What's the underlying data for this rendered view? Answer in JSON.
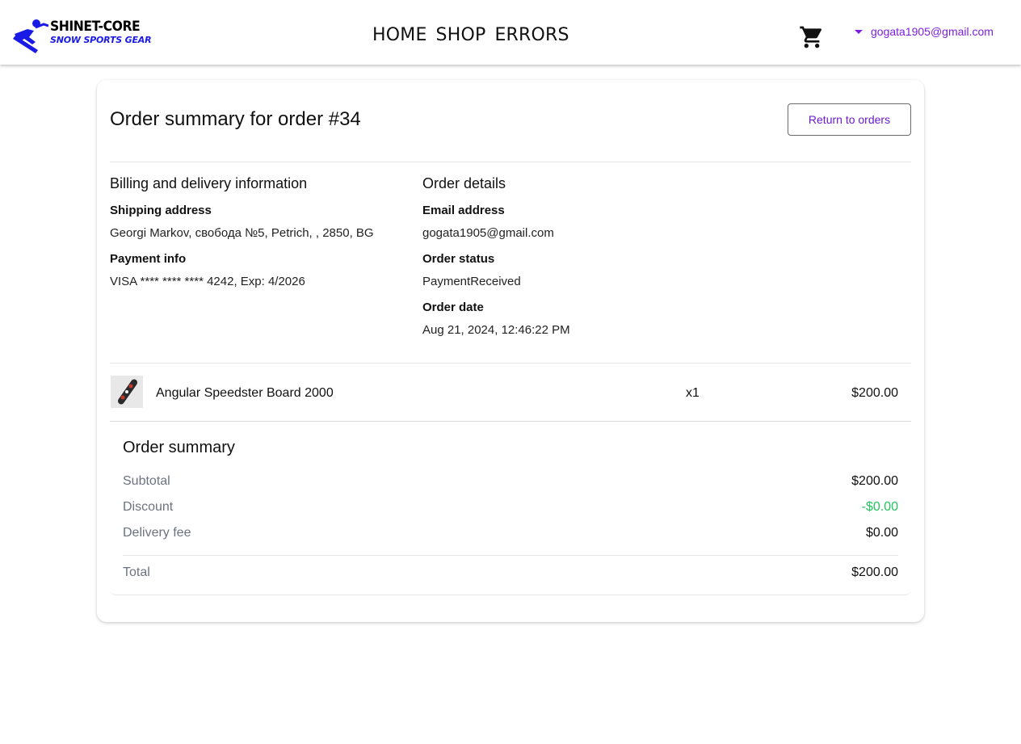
{
  "brand": {
    "line1": "SHINET-CORE",
    "line2": "SNOW SPORTS GEAR",
    "icon": "snowboarder-logo-icon",
    "color": "#1a1ae6"
  },
  "nav": {
    "items": [
      "HOME",
      "SHOP",
      "ERRORS"
    ]
  },
  "header": {
    "cart_icon": "shopping-cart-icon",
    "user_email": "gogata1905@gmail.com",
    "accent": "#7b1fe0"
  },
  "order": {
    "title": "Order summary for order #34",
    "return_button": "Return to orders"
  },
  "billing": {
    "heading": "Billing and delivery information",
    "shipping_label": "Shipping address",
    "shipping_value": "Georgi Markov, свобода №5, Petrich, , 2850, BG",
    "payment_label": "Payment info",
    "payment_value": "VISA **** **** **** 4242, Exp: 4/2026"
  },
  "details": {
    "heading": "Order details",
    "email_label": "Email address",
    "email_value": "gogata1905@gmail.com",
    "status_label": "Order status",
    "status_value": "PaymentReceived",
    "date_label": "Order date",
    "date_value": "Aug 21, 2024, 12:46:22 PM"
  },
  "items": [
    {
      "name": "Angular Speedster Board 2000",
      "quantity": "x1",
      "price": "$200.00"
    }
  ],
  "summary": {
    "title": "Order summary",
    "subtotal_label": "Subtotal",
    "subtotal_value": "$200.00",
    "discount_label": "Discount",
    "discount_value": "-$0.00",
    "delivery_label": "Delivery fee",
    "delivery_value": "$0.00",
    "total_label": "Total",
    "total_value": "$200.00",
    "discount_color": "#22c55e"
  }
}
